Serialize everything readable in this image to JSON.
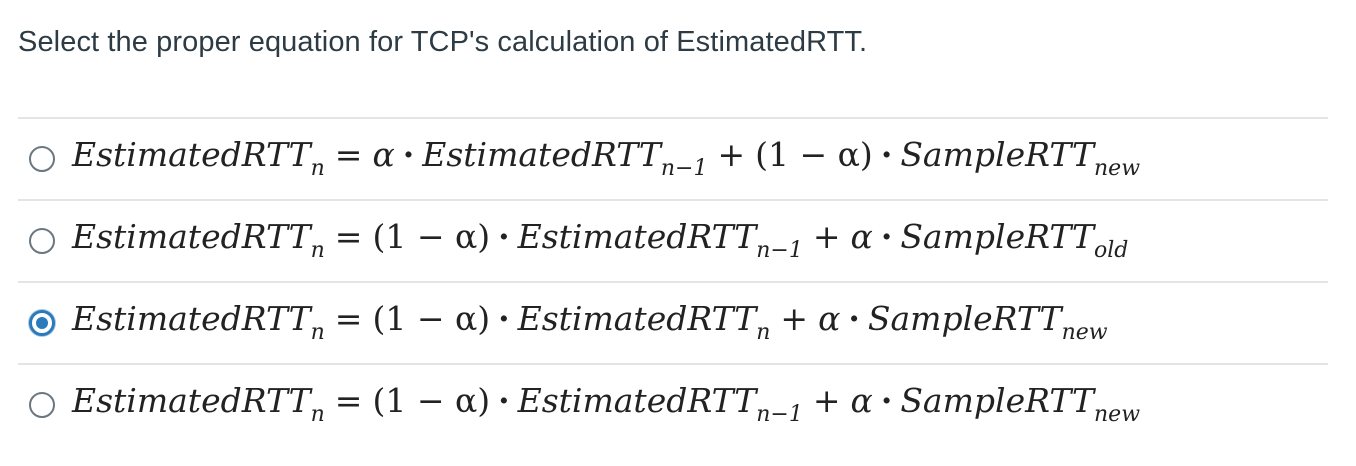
{
  "question": "Select the proper equation for TCP's calculation of EstimatedRTT.",
  "answers": [
    {
      "selected": false,
      "lhs": "EstimatedRTT",
      "lhs_sub": "n",
      "eq": "=",
      "coef1": "α",
      "dot1": "·",
      "term1": "EstimatedRTT",
      "term1_sub": "n−1",
      "plus": "+",
      "coef2": "(1 − α)",
      "dot2": "·",
      "term2": "SampleRTT",
      "term2_sub": "new"
    },
    {
      "selected": false,
      "lhs": "EstimatedRTT",
      "lhs_sub": "n",
      "eq": "=",
      "coef1": "(1 − α)",
      "dot1": "·",
      "term1": "EstimatedRTT",
      "term1_sub": "n−1",
      "plus": "+",
      "coef2": "α",
      "dot2": "·",
      "term2": "SampleRTT",
      "term2_sub": "old"
    },
    {
      "selected": true,
      "lhs": "EstimatedRTT",
      "lhs_sub": "n",
      "eq": "=",
      "coef1": "(1 − α)",
      "dot1": "·",
      "term1": "EstimatedRTT",
      "term1_sub": "n",
      "plus": "+",
      "coef2": "α",
      "dot2": "·",
      "term2": "SampleRTT",
      "term2_sub": "new"
    },
    {
      "selected": false,
      "lhs": "EstimatedRTT",
      "lhs_sub": "n",
      "eq": "=",
      "coef1": "(1 − α)",
      "dot1": "·",
      "term1": "EstimatedRTT",
      "term1_sub": "n−1",
      "plus": "+",
      "coef2": "α",
      "dot2": "·",
      "term2": "SampleRTT",
      "term2_sub": "new"
    }
  ],
  "colors": {
    "accent": "#2b7abc",
    "text": "#2d3b45",
    "divider": "#e2e5e8"
  }
}
